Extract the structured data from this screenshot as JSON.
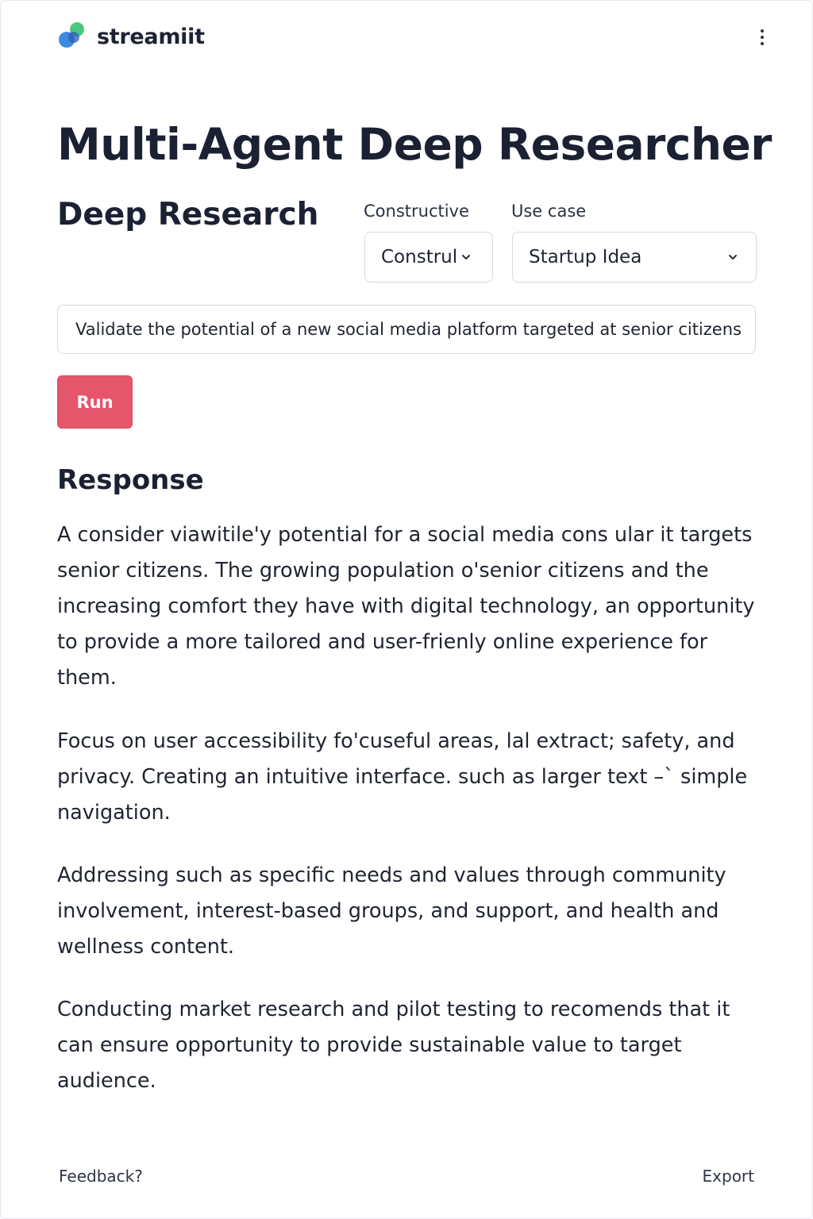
{
  "app": {
    "brand": "streamiit",
    "menu_icon": "vertical-ellipsis-icon",
    "accent_color": "#e5566d"
  },
  "main": {
    "title": "Multi-Agent Deep Researcher",
    "section_title": "Deep Research",
    "mode_select": {
      "label": "Constructive",
      "value": "Construl"
    },
    "usecase_select": {
      "label": "Use case",
      "value": "Startup Idea"
    },
    "query_value": "Validate the potential of a new social media platform targeted at senior citizens",
    "run_label": "Run"
  },
  "response": {
    "title": "Response",
    "paragraphs": [
      "A consider viawitile'y potential for a social media cons ular it targets senior citizens. The growing population o'senior citizens and the increasing comfort they have with digital technology, an opportunity to provide a more tailored and user-frienly online experience for them.",
      "Focus on user accessibility fo'cuseful areas, lal extract; safety, and privacy. Creating an intuitive interface. such as larger text –` simple navigation.",
      "Addressing such as specific needs and values through community involvement, interest-based groups, and support, and health and wellness content.",
      "Conducting market research and pilot testing to recomends that it can ensure opportunity to provide sustainable value to target audience."
    ]
  },
  "footer": {
    "feedback_label": "Feedback?",
    "export_label": "Export"
  }
}
